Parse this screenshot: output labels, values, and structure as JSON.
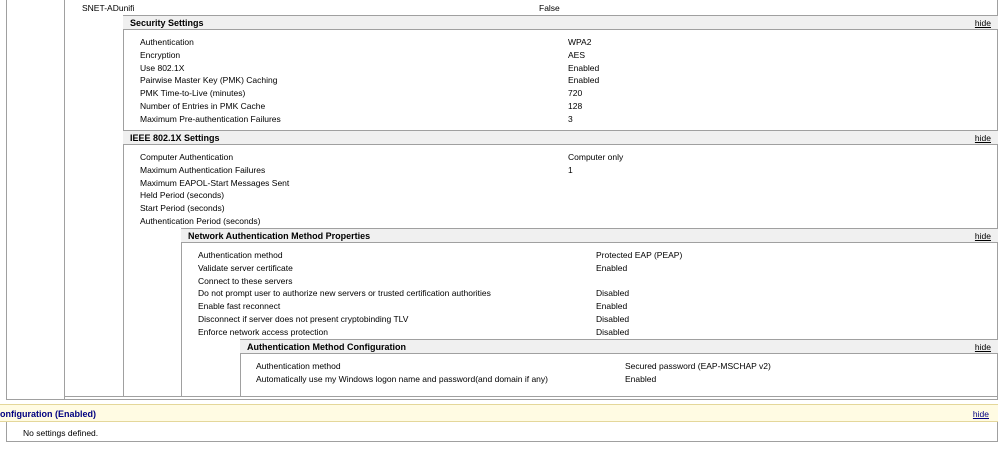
{
  "top_row": {
    "key": "SNET-ADunifi",
    "value": "False"
  },
  "security": {
    "title": "Security Settings",
    "hide": "hide",
    "rows": [
      {
        "key": "Authentication",
        "value": "WPA2"
      },
      {
        "key": "Encryption",
        "value": "AES"
      },
      {
        "key": "Use 802.1X",
        "value": "Enabled"
      },
      {
        "key": "Pairwise Master Key (PMK) Caching",
        "value": "Enabled"
      },
      {
        "key": "PMK Time-to-Live (minutes)",
        "value": "720"
      },
      {
        "key": "Number of Entries in PMK Cache",
        "value": "128"
      },
      {
        "key": "Maximum Pre-authentication Failures",
        "value": "3"
      }
    ]
  },
  "ieee": {
    "title": "IEEE 802.1X Settings",
    "hide": "hide",
    "rows": [
      {
        "key": "Computer Authentication",
        "value": "Computer only"
      },
      {
        "key": "Maximum Authentication Failures",
        "value": "1"
      },
      {
        "key": "Maximum EAPOL-Start Messages Sent",
        "value": ""
      },
      {
        "key": "Held Period (seconds)",
        "value": ""
      },
      {
        "key": "Start Period (seconds)",
        "value": ""
      },
      {
        "key": "Authentication Period (seconds)",
        "value": ""
      }
    ]
  },
  "network_auth": {
    "title": "Network Authentication Method Properties",
    "hide": "hide",
    "rows": [
      {
        "key": "Authentication method",
        "value": "Protected EAP (PEAP)"
      },
      {
        "key": "Validate server certificate",
        "value": "Enabled"
      },
      {
        "key": "Connect to these servers",
        "value": ""
      },
      {
        "key": "Do not prompt user to authorize new servers or trusted certification authorities",
        "value": "Disabled"
      },
      {
        "key": "Enable fast reconnect",
        "value": "Enabled"
      },
      {
        "key": "Disconnect if server does not present cryptobinding TLV",
        "value": "Disabled"
      },
      {
        "key": "Enforce network access protection",
        "value": "Disabled"
      }
    ]
  },
  "auth_method_config": {
    "title": "Authentication Method Configuration",
    "hide": "hide",
    "rows": [
      {
        "key": "Authentication method",
        "value": "Secured password (EAP-MSCHAP v2)"
      },
      {
        "key": "Automatically use my Windows logon name and password(and domain if any)",
        "value": "Enabled"
      }
    ]
  },
  "config_bar": {
    "title": "onfiguration (Enabled)",
    "hide": "hide"
  },
  "no_settings": "No settings defined."
}
